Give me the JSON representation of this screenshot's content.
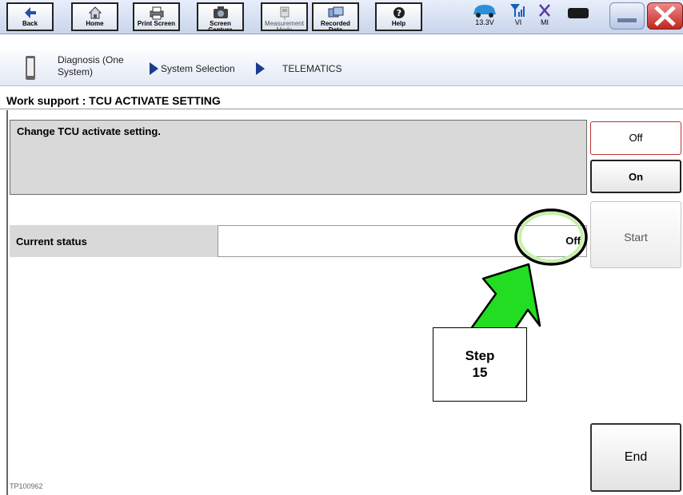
{
  "toolbar": {
    "buttons": [
      {
        "label": "Back",
        "icon": "arrow-left-icon"
      },
      {
        "label": "Home",
        "icon": "home-icon"
      },
      {
        "label": "Print Screen",
        "icon": "printer-icon"
      },
      {
        "label": "Screen Capture",
        "icon": "camera-icon"
      },
      {
        "label": "Measurement Mode",
        "icon": "meter-icon"
      },
      {
        "label": "Recorded Data",
        "icon": "recorded-data-icon"
      },
      {
        "label": "Help",
        "icon": "help-icon"
      }
    ],
    "battery_voltage": "13.3V",
    "vi_label": "VI",
    "mi_label": "MI"
  },
  "breadcrumb": {
    "diagnosis_line1": "Diagnosis (One",
    "diagnosis_line2": "System)",
    "system_selection": "System Selection",
    "current": "TELEMATICS"
  },
  "page": {
    "title": "Work support : TCU ACTIVATE SETTING",
    "description": "Change TCU activate setting.",
    "current_status_label": "Current status",
    "current_status_value": "Off"
  },
  "side_buttons": {
    "off": "Off",
    "on": "On",
    "start": "Start",
    "end": "End"
  },
  "callout": {
    "line1": "Step",
    "line2": "15"
  },
  "footer_id": "TP100962",
  "colors": {
    "arrow_fill": "#22dd22",
    "highlight_circle": "#c6f0a8",
    "close_button": "#d0302a"
  }
}
